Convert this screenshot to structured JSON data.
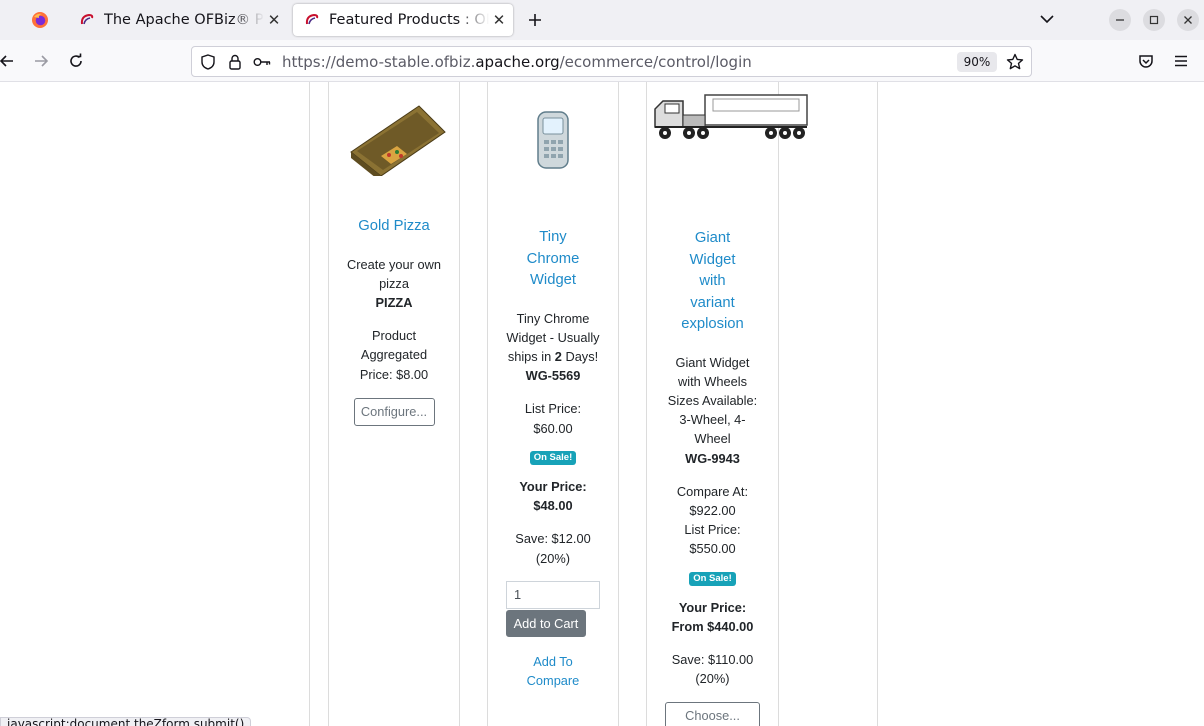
{
  "browser": {
    "tabs": [
      {
        "title": "The Apache OFBiz® Proje"
      },
      {
        "title": "Featured Products : OFBiz"
      }
    ],
    "url": {
      "prefix": "https://demo-stable.ofbiz.",
      "domain": "apache.org",
      "path": "/ecommerce/control/login"
    },
    "zoom": "90%",
    "status_text": "javascript:document.theZform.submit()"
  },
  "products": [
    {
      "name": "Gold Pizza",
      "description": "Create your own pizza",
      "sku": "PIZZA",
      "aggregated_price_label": "Product Aggregated Price: $8.00",
      "action_button": "Configure..."
    },
    {
      "name": "Tiny Chrome Widget",
      "description_pre": "Tiny Chrome Widget - Usually ships in ",
      "description_bold": "2",
      "description_post": " Days!",
      "sku": "WG-5569",
      "list_price_label": "List Price:",
      "list_price": "$60.00",
      "badge": "On Sale!",
      "your_price_label": "Your Price:",
      "your_price": "$48.00",
      "save_amount": "Save: $12.00",
      "save_percent": "(20%)",
      "quantity_value": "1",
      "add_to_cart": "Add to Cart",
      "compare_link": "Add To Compare"
    },
    {
      "name": "Giant Widget with variant explosion",
      "description": "Giant Widget with Wheels Sizes Available: 3-Wheel, 4-Wheel",
      "sku": "WG-9943",
      "compare_at_label": "Compare At:",
      "compare_at": "$922.00",
      "list_price_label": "List Price:",
      "list_price": "$550.00",
      "badge": "On Sale!",
      "your_price_label": "Your Price:",
      "your_price": "From $440.00",
      "save_amount": "Save: $110.00",
      "save_percent": "(20%)",
      "action_button": "Choose..."
    }
  ],
  "colors": {
    "link": "#1f8bc9",
    "badge": "#17a2b8",
    "cart_button": "#6c757d"
  }
}
